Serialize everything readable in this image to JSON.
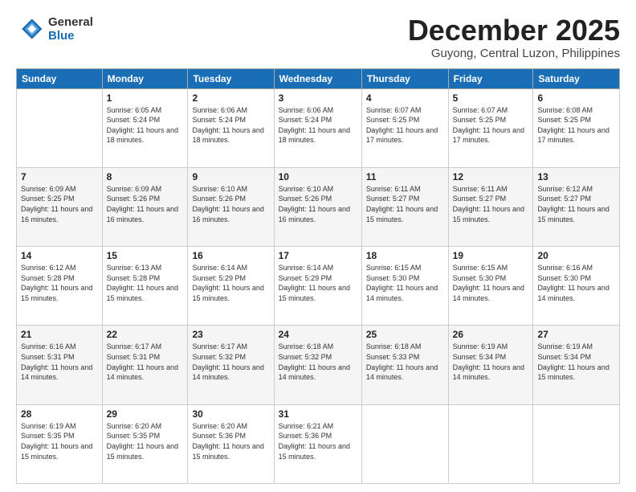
{
  "header": {
    "logo_general": "General",
    "logo_blue": "Blue",
    "month_title": "December 2025",
    "location": "Guyong, Central Luzon, Philippines"
  },
  "days_of_week": [
    "Sunday",
    "Monday",
    "Tuesday",
    "Wednesday",
    "Thursday",
    "Friday",
    "Saturday"
  ],
  "weeks": [
    [
      {
        "day": "",
        "info": ""
      },
      {
        "day": "1",
        "info": "Sunrise: 6:05 AM\nSunset: 5:24 PM\nDaylight: 11 hours and 18 minutes."
      },
      {
        "day": "2",
        "info": "Sunrise: 6:06 AM\nSunset: 5:24 PM\nDaylight: 11 hours and 18 minutes."
      },
      {
        "day": "3",
        "info": "Sunrise: 6:06 AM\nSunset: 5:24 PM\nDaylight: 11 hours and 18 minutes."
      },
      {
        "day": "4",
        "info": "Sunrise: 6:07 AM\nSunset: 5:25 PM\nDaylight: 11 hours and 17 minutes."
      },
      {
        "day": "5",
        "info": "Sunrise: 6:07 AM\nSunset: 5:25 PM\nDaylight: 11 hours and 17 minutes."
      },
      {
        "day": "6",
        "info": "Sunrise: 6:08 AM\nSunset: 5:25 PM\nDaylight: 11 hours and 17 minutes."
      }
    ],
    [
      {
        "day": "7",
        "info": "Sunrise: 6:09 AM\nSunset: 5:25 PM\nDaylight: 11 hours and 16 minutes."
      },
      {
        "day": "8",
        "info": "Sunrise: 6:09 AM\nSunset: 5:26 PM\nDaylight: 11 hours and 16 minutes."
      },
      {
        "day": "9",
        "info": "Sunrise: 6:10 AM\nSunset: 5:26 PM\nDaylight: 11 hours and 16 minutes."
      },
      {
        "day": "10",
        "info": "Sunrise: 6:10 AM\nSunset: 5:26 PM\nDaylight: 11 hours and 16 minutes."
      },
      {
        "day": "11",
        "info": "Sunrise: 6:11 AM\nSunset: 5:27 PM\nDaylight: 11 hours and 15 minutes."
      },
      {
        "day": "12",
        "info": "Sunrise: 6:11 AM\nSunset: 5:27 PM\nDaylight: 11 hours and 15 minutes."
      },
      {
        "day": "13",
        "info": "Sunrise: 6:12 AM\nSunset: 5:27 PM\nDaylight: 11 hours and 15 minutes."
      }
    ],
    [
      {
        "day": "14",
        "info": "Sunrise: 6:12 AM\nSunset: 5:28 PM\nDaylight: 11 hours and 15 minutes."
      },
      {
        "day": "15",
        "info": "Sunrise: 6:13 AM\nSunset: 5:28 PM\nDaylight: 11 hours and 15 minutes."
      },
      {
        "day": "16",
        "info": "Sunrise: 6:14 AM\nSunset: 5:29 PM\nDaylight: 11 hours and 15 minutes."
      },
      {
        "day": "17",
        "info": "Sunrise: 6:14 AM\nSunset: 5:29 PM\nDaylight: 11 hours and 15 minutes."
      },
      {
        "day": "18",
        "info": "Sunrise: 6:15 AM\nSunset: 5:30 PM\nDaylight: 11 hours and 14 minutes."
      },
      {
        "day": "19",
        "info": "Sunrise: 6:15 AM\nSunset: 5:30 PM\nDaylight: 11 hours and 14 minutes."
      },
      {
        "day": "20",
        "info": "Sunrise: 6:16 AM\nSunset: 5:30 PM\nDaylight: 11 hours and 14 minutes."
      }
    ],
    [
      {
        "day": "21",
        "info": "Sunrise: 6:16 AM\nSunset: 5:31 PM\nDaylight: 11 hours and 14 minutes."
      },
      {
        "day": "22",
        "info": "Sunrise: 6:17 AM\nSunset: 5:31 PM\nDaylight: 11 hours and 14 minutes."
      },
      {
        "day": "23",
        "info": "Sunrise: 6:17 AM\nSunset: 5:32 PM\nDaylight: 11 hours and 14 minutes."
      },
      {
        "day": "24",
        "info": "Sunrise: 6:18 AM\nSunset: 5:32 PM\nDaylight: 11 hours and 14 minutes."
      },
      {
        "day": "25",
        "info": "Sunrise: 6:18 AM\nSunset: 5:33 PM\nDaylight: 11 hours and 14 minutes."
      },
      {
        "day": "26",
        "info": "Sunrise: 6:19 AM\nSunset: 5:34 PM\nDaylight: 11 hours and 14 minutes."
      },
      {
        "day": "27",
        "info": "Sunrise: 6:19 AM\nSunset: 5:34 PM\nDaylight: 11 hours and 15 minutes."
      }
    ],
    [
      {
        "day": "28",
        "info": "Sunrise: 6:19 AM\nSunset: 5:35 PM\nDaylight: 11 hours and 15 minutes."
      },
      {
        "day": "29",
        "info": "Sunrise: 6:20 AM\nSunset: 5:35 PM\nDaylight: 11 hours and 15 minutes."
      },
      {
        "day": "30",
        "info": "Sunrise: 6:20 AM\nSunset: 5:36 PM\nDaylight: 11 hours and 15 minutes."
      },
      {
        "day": "31",
        "info": "Sunrise: 6:21 AM\nSunset: 5:36 PM\nDaylight: 11 hours and 15 minutes."
      },
      {
        "day": "",
        "info": ""
      },
      {
        "day": "",
        "info": ""
      },
      {
        "day": "",
        "info": ""
      }
    ]
  ]
}
